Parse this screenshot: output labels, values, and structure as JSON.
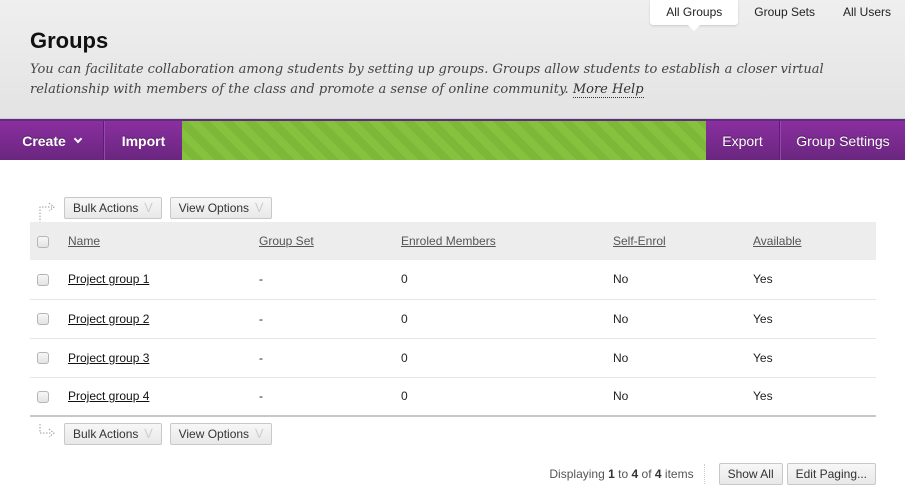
{
  "tabs": [
    {
      "label": "All Groups",
      "active": true
    },
    {
      "label": "Group Sets",
      "active": false
    },
    {
      "label": "All Users",
      "active": false
    }
  ],
  "header": {
    "title": "Groups",
    "description": "You can facilitate collaboration among students by setting up groups. Groups allow students to establish a closer virtual relationship with members of the class and promote a sense of online community.",
    "help_link": "More Help"
  },
  "action_bar": {
    "create": "Create",
    "import": "Import",
    "export": "Export",
    "group_settings": "Group Settings"
  },
  "list_toolbar": {
    "bulk_actions": "Bulk Actions",
    "view_options": "View Options"
  },
  "table": {
    "columns": [
      "Name",
      "Group Set",
      "Enroled Members",
      "Self-Enrol",
      "Available"
    ],
    "rows": [
      {
        "name": "Project group 1",
        "group_set": "-",
        "members": "0",
        "self_enrol": "No",
        "available": "Yes"
      },
      {
        "name": "Project group 2",
        "group_set": "-",
        "members": "0",
        "self_enrol": "No",
        "available": "Yes"
      },
      {
        "name": "Project group 3",
        "group_set": "-",
        "members": "0",
        "self_enrol": "No",
        "available": "Yes"
      },
      {
        "name": "Project group 4",
        "group_set": "-",
        "members": "0",
        "self_enrol": "No",
        "available": "Yes"
      }
    ]
  },
  "paging": {
    "prefix": "Displaying",
    "from": "1",
    "to_word": "to",
    "to": "4",
    "of_word": "of",
    "total": "4",
    "suffix": "items",
    "show_all": "Show All",
    "edit_paging": "Edit Paging..."
  },
  "colors": {
    "brand_purple": "#7a2b93",
    "accent_green": "#86c23e"
  }
}
